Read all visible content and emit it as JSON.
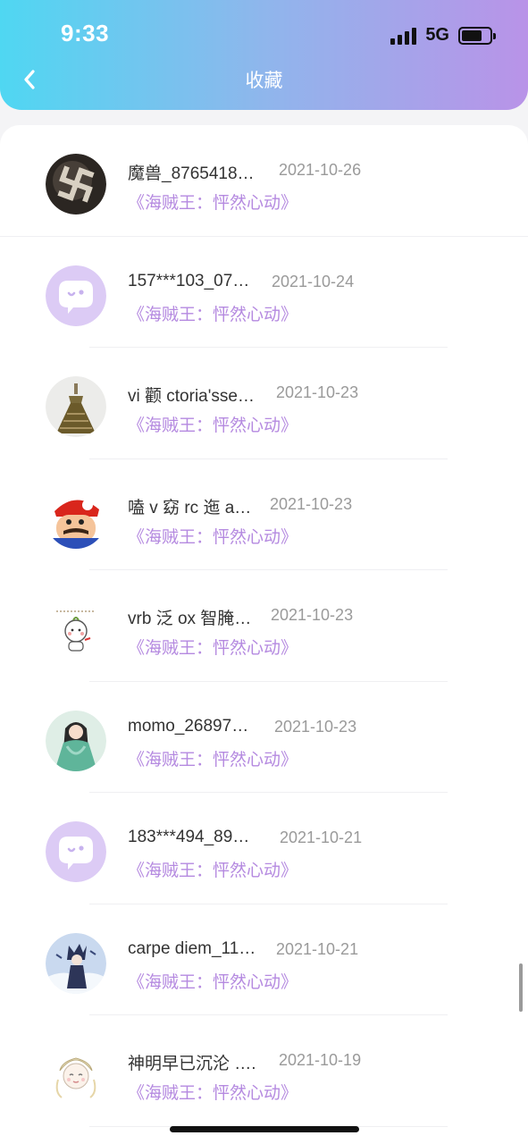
{
  "status_bar": {
    "time": "9:33",
    "network": "5G"
  },
  "header": {
    "title": "收藏"
  },
  "items": [
    {
      "name": "魔兽_8765418…",
      "date": "2021-10-26",
      "source": "《海贼王：怦然心动》",
      "avatar": "swastika-dark-avatar"
    },
    {
      "name": "157***103_07…",
      "date": "2021-10-24",
      "source": "《海贼王：怦然心动》",
      "avatar": "default-chat-avatar"
    },
    {
      "name": "vi 颧 ctoria'sse…",
      "date": "2021-10-23",
      "source": "《海贼王：怦然心动》",
      "avatar": "dress-avatar"
    },
    {
      "name": "嗑 v 窈 rc 迤 a…",
      "date": "2021-10-23",
      "source": "《海贼王：怦然心动》",
      "avatar": "cartoon-plumber-avatar"
    },
    {
      "name": "vrb 泛 ox 智腌…",
      "date": "2021-10-23",
      "source": "《海贼王：怦然心动》",
      "avatar": "cute-character-avatar"
    },
    {
      "name": "momo_26897…",
      "date": "2021-10-23",
      "source": "《海贼王：怦然心动》",
      "avatar": "anime-girl-avatar"
    },
    {
      "name": "183***494_89…",
      "date": "2021-10-21",
      "source": "《海贼王：怦然心动》",
      "avatar": "default-chat-avatar"
    },
    {
      "name": "carpe diem_11…",
      "date": "2021-10-21",
      "source": "《海贼王：怦然心动》",
      "avatar": "anime-figure-avatar"
    },
    {
      "name": "神明早已沉沦 ….",
      "date": "2021-10-19",
      "source": "《海贼王：怦然心动》",
      "avatar": "anime-sketch-avatar"
    }
  ]
}
